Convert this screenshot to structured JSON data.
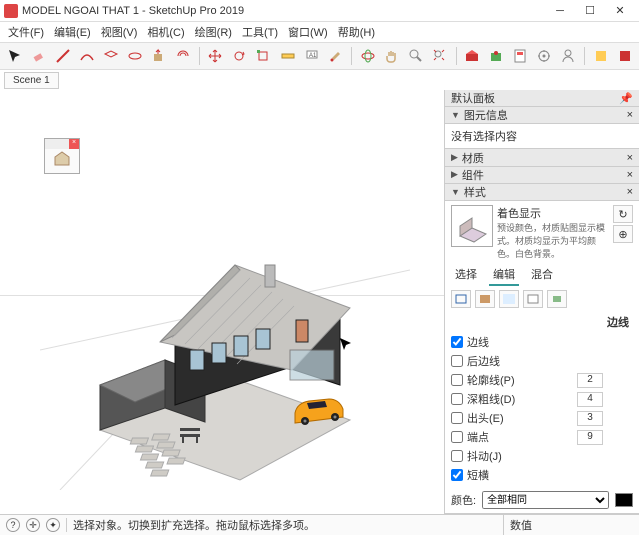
{
  "window": {
    "title": "MODEL NGOAI THAT 1 - SketchUp Pro 2019"
  },
  "menus": [
    "文件(F)",
    "编辑(E)",
    "视图(V)",
    "相机(C)",
    "绘图(R)",
    "工具(T)",
    "窗口(W)",
    "帮助(H)"
  ],
  "scene_tab": "Scene 1",
  "panels": {
    "default_title": "默认面板",
    "entity_info": "图元信息",
    "no_selection": "没有选择内容",
    "materials": "材质",
    "components": "组件",
    "styles": "样式",
    "style_name": "着色显示",
    "style_desc": "预设颜色，材质贴图显示模式。材质均显示为平均颜色。白色背景。",
    "tabs": {
      "select": "选择",
      "edit": "编辑",
      "mix": "混合"
    },
    "edges_section": "边线",
    "checks": {
      "edges": "边线",
      "back_edges": "后边线",
      "profiles": "轮廓线(P)",
      "depth_cue": "深粗线(D)",
      "extension": "出头(E)",
      "endpoints": "端点",
      "jitter": "抖动(J)",
      "dashes": "短横"
    },
    "vals": {
      "profiles": "2",
      "depth_cue": "4",
      "extension": "3",
      "endpoints": "9"
    },
    "color_label": "颜色:",
    "color_option": "全部相同"
  },
  "status": {
    "hint": "选择对象。切换到扩充选择。拖动鼠标选择多项。",
    "measure_label": "数值"
  }
}
